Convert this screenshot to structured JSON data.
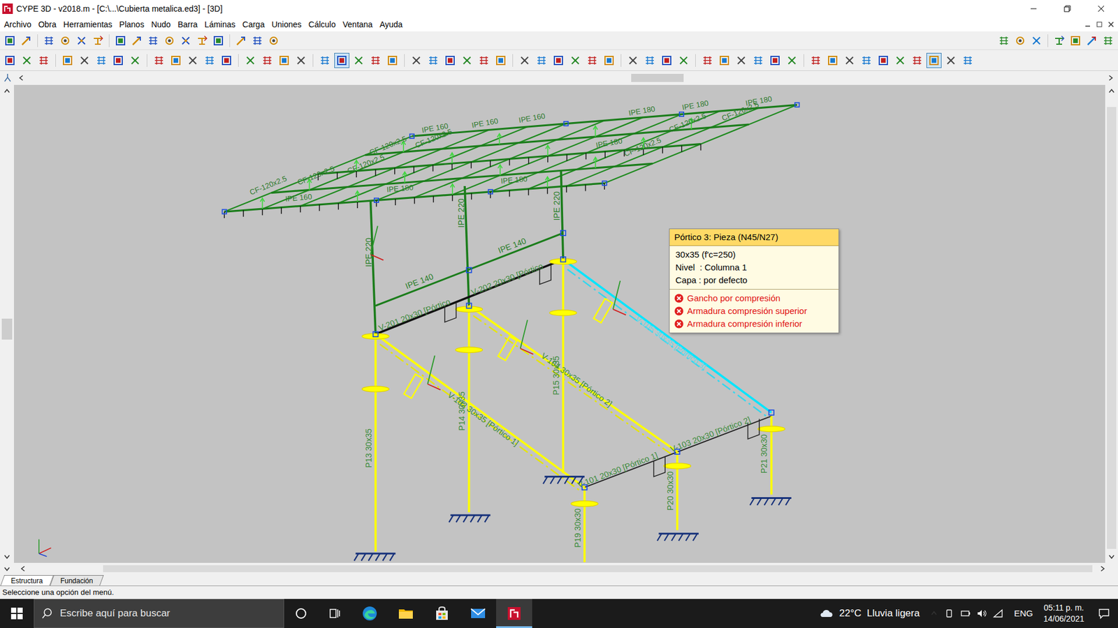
{
  "window": {
    "title": "CYPE 3D - v2018.m - [C:\\...\\Cubierta metalica.ed3] - [3D]"
  },
  "menu": [
    "Archivo",
    "Obra",
    "Herramientas",
    "Planos",
    "Nudo",
    "Barra",
    "Láminas",
    "Carga",
    "Uniones",
    "Cálculo",
    "Ventana",
    "Ayuda"
  ],
  "viewport": {
    "bar_labels": [
      {
        "text": "CF-120x2.5",
        "selected": false
      },
      {
        "text": "CF-120x2.5",
        "selected": false
      },
      {
        "text": "CF-120x2.5",
        "selected": false
      },
      {
        "text": "CF-120x2.5",
        "selected": false
      },
      {
        "text": "CF-120x2.5",
        "selected": false
      },
      {
        "text": "CF-120x2.5",
        "selected": false
      },
      {
        "text": "CF-120x2.5",
        "selected": false
      },
      {
        "text": "CF-120x2.5",
        "selected": false
      },
      {
        "text": "IPE 160",
        "selected": false
      },
      {
        "text": "IPE 160",
        "selected": false
      },
      {
        "text": "IPE 160",
        "selected": false
      },
      {
        "text": "IPE 160",
        "selected": false
      },
      {
        "text": "IPE 180",
        "selected": false
      },
      {
        "text": "IPE 180",
        "selected": false
      },
      {
        "text": "IPE 180",
        "selected": false
      },
      {
        "text": "IPE 180",
        "selected": false
      },
      {
        "text": "IPE 180",
        "selected": false
      },
      {
        "text": "IPE 180",
        "selected": false
      },
      {
        "text": "IPE 220",
        "selected": false
      },
      {
        "text": "IPE 220",
        "selected": false
      },
      {
        "text": "IPE 220",
        "selected": false
      },
      {
        "text": "IPE 140",
        "selected": false
      },
      {
        "text": "IPE 140",
        "selected": false
      },
      {
        "text": "V-201 20x30 [Pórtico",
        "selected": false
      },
      {
        "text": "V-202 20x30 [Pórtico",
        "selected": false
      },
      {
        "text": "V-102 30x35 [Pórtico 1]",
        "selected": false
      },
      {
        "text": "V-104 30x35 [Pórtico 2]",
        "selected": false
      },
      {
        "text": "V-105 30x35 [Pórtico 3]",
        "selected": true
      },
      {
        "text": "V-101 20x30 [Pórtico 1]",
        "selected": false
      },
      {
        "text": "V-103 20x30 [Pórtico 2]",
        "selected": false
      },
      {
        "text": "P13 30x35",
        "selected": false
      },
      {
        "text": "P14 30x35",
        "selected": false
      },
      {
        "text": "P15 30x35",
        "selected": false
      },
      {
        "text": "P19 30x30",
        "selected": false
      },
      {
        "text": "P20 30x30",
        "selected": false
      },
      {
        "text": "P21 30x30",
        "selected": false
      }
    ],
    "tooltip": {
      "title": "Pórtico 3: Pieza (N45/N27)",
      "lines": [
        "30x35 (f'c=250)",
        "Nivel  : Columna 1",
        "Capa : por defecto"
      ],
      "errors": [
        "Gancho por compresión",
        "Armadura compresión superior",
        "Armadura compresión inferior"
      ]
    }
  },
  "tabs": [
    {
      "label": "Estructura",
      "selected": true
    },
    {
      "label": "Fundación",
      "selected": false
    }
  ],
  "status_bar": "Seleccione una opción del menú.",
  "taskbar": {
    "search_placeholder": "Escribe aquí para buscar",
    "weather": "22°C  Lluvia ligera",
    "language": "ENG",
    "time": "05:11 p. m.",
    "date": "14/06/2021",
    "apps": [
      {
        "kind": "edge",
        "selected": false
      },
      {
        "kind": "explorer",
        "selected": false
      },
      {
        "kind": "store",
        "selected": false
      },
      {
        "kind": "mail",
        "selected": false
      },
      {
        "kind": "cype",
        "selected": true
      }
    ]
  }
}
